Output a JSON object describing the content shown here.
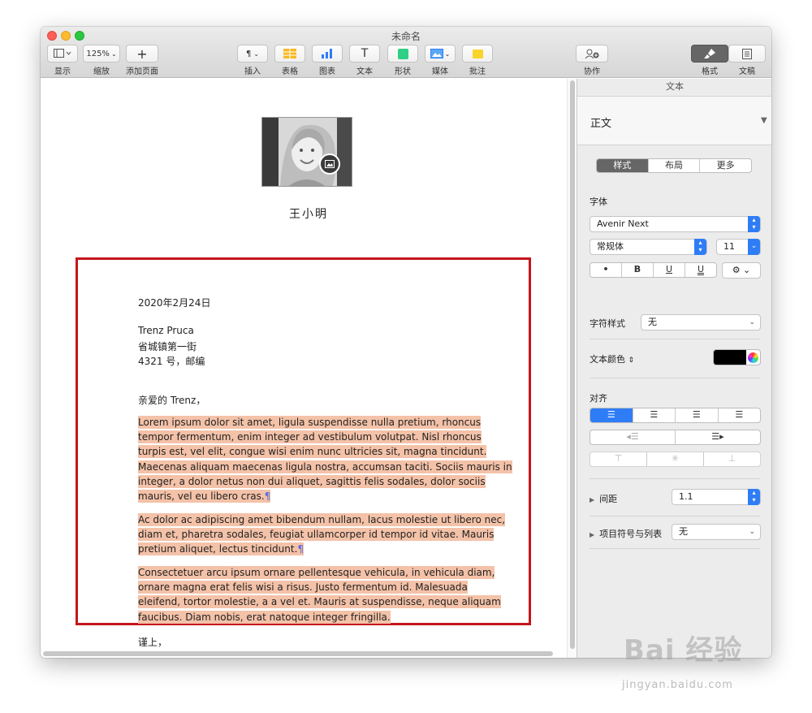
{
  "window": {
    "title": "未命名"
  },
  "toolbar": {
    "view": "显示",
    "zoom_value": "125%",
    "zoom": "缩放",
    "add_page": "添加页面",
    "insert": "插入",
    "table": "表格",
    "chart": "图表",
    "text": "文本",
    "shape": "形状",
    "media": "媒体",
    "comment": "批注",
    "collaborate": "协作",
    "format": "格式",
    "document": "文稿"
  },
  "document": {
    "name": "王小明",
    "date": "2020年2月24日",
    "address": [
      "Trenz Pruca",
      "省城镇第一街",
      "4321 号，邮编"
    ],
    "greeting": "亲爱的 Trenz，",
    "paragraphs": [
      [
        "Lorem ipsum dolor sit amet, ligula suspendisse nulla pretium, rhoncus",
        "tempor fermentum, enim integer ad vestibulum volutpat. Nisl rhoncus",
        "turpis est, vel elit, congue wisi enim nunc ultricies sit, magna tincidunt.",
        "Maecenas aliquam maecenas ligula nostra, accumsan taciti. Sociis mauris in",
        "integer, a dolor netus non dui aliquet, sagittis felis sodales, dolor sociis",
        "mauris, vel eu libero cras."
      ],
      [
        "Ac dolor ac adipiscing amet bibendum nullam, lacus molestie ut libero nec,",
        "diam et, pharetra sodales, feugiat ullamcorper id tempor id vitae. Mauris",
        "pretium aliquet, lectus tincidunt."
      ],
      [
        "Consectetuer arcu ipsum ornare pellentesque vehicula, in vehicula diam,",
        "ornare magna erat felis wisi a risus. Justo fermentum id. Malesuada",
        "eleifend, tortor molestie, a a vel et. Mauris at suspendisse, neque aliquam",
        "faucibus. Diam nobis, erat natoque integer fringilla."
      ]
    ],
    "pilcrow": "¶",
    "closing": "谨上，"
  },
  "sidebar": {
    "header": "文本",
    "paragraph_style": "正文",
    "tabs": [
      "样式",
      "布局",
      "更多"
    ],
    "font_label": "字体",
    "font_family": "Avenir Next",
    "font_weight": "常规体",
    "font_size": "11",
    "style_buttons": [
      "•",
      "B",
      "U",
      "U"
    ],
    "char_style_label": "字符样式",
    "char_style_value": "无",
    "text_color_label": "文本颜色",
    "text_color": "#000000",
    "align_label": "对齐",
    "spacing_label": "间距",
    "spacing_value": "1.1",
    "bullets_label": "项目符号与列表",
    "bullets_value": "无"
  },
  "watermark": {
    "brand": "Bai 经验",
    "url": "jingyan.baidu.com"
  }
}
